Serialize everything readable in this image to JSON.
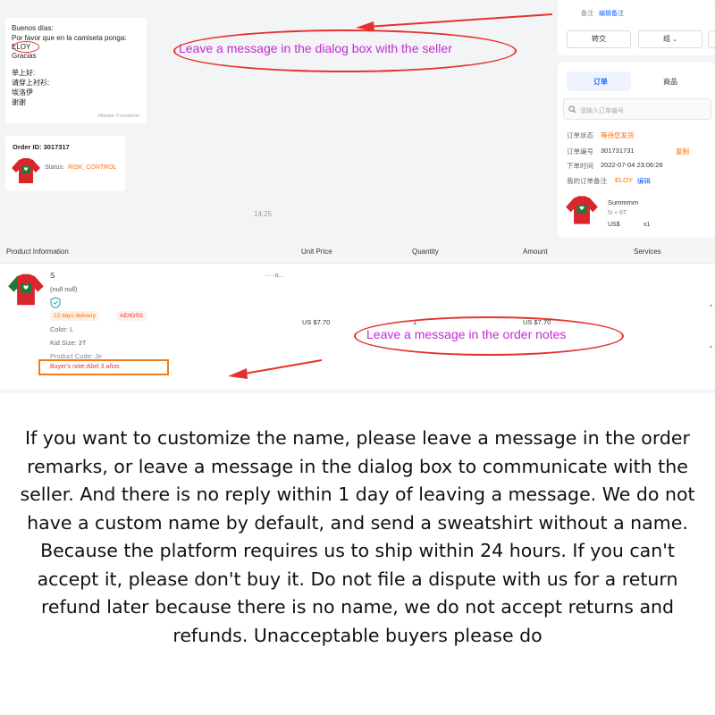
{
  "chat": {
    "message_lines": [
      "Buenos días:",
      "Por favor que en la camiseta ponga:",
      "ELOY",
      "Gracias",
      "单上好:",
      "请穿上衬衫:",
      "埃洛伊",
      "谢谢"
    ],
    "translation_label": "Alibaba Translation",
    "order_id": "Order ID: 3017317",
    "status_label": "Status:",
    "status_value": "RISK_CONTROL",
    "time": "14:25"
  },
  "right_panel": {
    "note_label": "备注",
    "edit_note": "编辑备注",
    "transfer_button": "转交",
    "group_button": "组",
    "tab_orders": "订单",
    "tab_products": "商品",
    "search_placeholder": "请输入订单编号",
    "order_status_label": "订单状态",
    "order_status_value": "等待您发货",
    "order_no_label": "订单编号",
    "order_no_value": "301731731",
    "copy_label": "复制",
    "order_time_label": "下单时间",
    "order_time_value": "2022-07-04 23:06:26",
    "my_note_label": "我的订单备注",
    "my_note_value": "ELOY",
    "my_note_edit": "编辑",
    "product_title": "Summmm",
    "product_variant": "N + 6T",
    "product_price": "US$",
    "product_qty": "x1"
  },
  "table": {
    "headers": [
      "Product Information",
      "Unit Price",
      "Quantity",
      "Amount",
      "Services"
    ],
    "product_title": "S",
    "product_title_tail": "·····o...",
    "null_text": "(null null)",
    "tag_delivery": "12 days delivery",
    "tag_ioss": "AE/IOSS",
    "color": "Color: L",
    "kid_size": "Kid Size: 3T",
    "product_code": "Product Code: Je",
    "buyer_note": "Buyer's note:Abel 3 años",
    "unit_price": "US $7.70",
    "quantity": "1",
    "amount": "US $7.70"
  },
  "annotations": {
    "dialog_note": "Leave a message in the dialog box with the seller",
    "order_note": "Leave a message in the order notes"
  },
  "notice": "If you want to customize the name, please leave a message in the order remarks, or leave a message in the dialog box to communicate with the seller. And there is no reply within 1 day of leaving a message. We do not have a custom name by default, and send a sweatshirt without a name. Because the platform requires us to ship within 24 hours. If you can't accept it, please don't buy it. Do not file a dispute with us for a return refund later because there is no name, we do not accept returns and refunds. Unacceptable buyers please do",
  "colors": {
    "annotation_red": "#e5322d",
    "annotation_text": "#c22bd0",
    "status_orange": "#ff6a00",
    "link_blue": "#1a66ff"
  },
  "icons": [
    "shield-check-icon",
    "search-icon",
    "chevron-down-icon",
    "arrow-icon",
    "sweatshirt-thumbnail"
  ]
}
